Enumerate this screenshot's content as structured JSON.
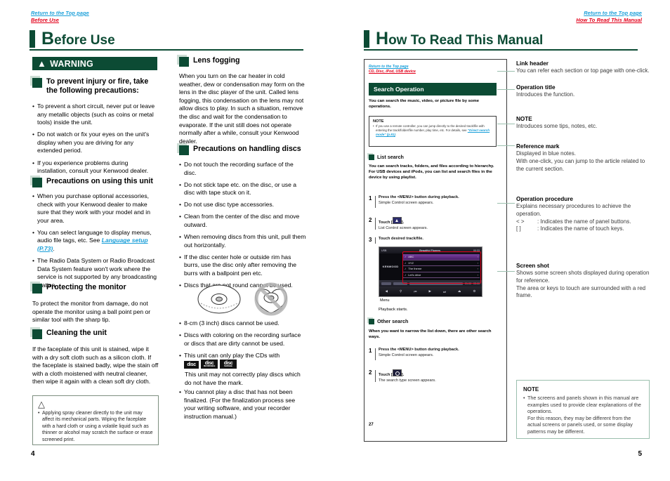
{
  "left_page": {
    "link_header": {
      "top": "Return to the Top page",
      "section": "Before Use"
    },
    "chapter_title_cap": "B",
    "chapter_title_rest": "efore Use",
    "warning_label": "WARNING",
    "warning_icon": "warning-triangle-icon",
    "page_number": "4",
    "col1": {
      "h1": "To prevent injury or fire, take the following precautions:",
      "h1_bullets": [
        "To prevent a short circuit, never put or leave any metallic objects (such as coins or metal tools) inside the unit.",
        "Do not watch or fix your eyes on the unit's display when you are driving for any extended period.",
        "If you experience problems during installation, consult your Kenwood dealer."
      ],
      "h2": "Precautions on using this unit",
      "h2_bullets_a": "When you purchase optional accessories, check with your Kenwood dealer to make sure that they work with your model and in your area.",
      "h2_bullets_b_pre": "You can select language to display menus, audio file tags, etc. See ",
      "h2_bullets_b_link": "Language setup (P.73)",
      "h2_bullets_b_post": ".",
      "h2_bullets_c": "The Radio Data System or Radio Broadcast Data System feature won't work where the service is not supported by any broadcasting station.",
      "h3": "Protecting the monitor",
      "h3_body": "To protect the monitor from damage, do not operate the monitor using a ball point pen or similar tool with the sharp tip.",
      "h4": "Cleaning the unit",
      "h4_body": "If the faceplate of this unit is stained, wipe it with a dry soft cloth such as a silicon cloth. If the faceplate is stained badly, wipe the stain off with a cloth moistened with neutral cleaner, then wipe it again with a clean soft dry cloth.",
      "caution_icon": "caution-triangle-icon",
      "caution_text": "Applying spray cleaner directly to the unit may affect its mechanical parts. Wiping the faceplate with a hard cloth or using a volatile liquid such as thinner or alcohol may scratch the surface or erase screened print."
    },
    "col2": {
      "h1": "Lens fogging",
      "h1_body": "When you turn on the car heater in cold weather, dew or condensation may form on the lens in the disc player of the unit. Called lens fogging, this condensation on the lens may not allow discs to play. In such a situation, remove the disc and wait for the condensation to evaporate. If the unit still does not operate normally after a while, consult your Kenwood dealer.",
      "h2": "Precautions on handling discs",
      "h2_bullets": [
        "Do not touch the recording surface of the disc.",
        "Do not stick tape etc. on the disc, or use a disc with tape stuck on it.",
        "Do not use disc type accessories.",
        "Clean from the center of the disc and move outward.",
        "When removing discs from this unit, pull them out horizontally.",
        "If the disc center hole or outside rim has burrs, use the disc only after removing the burrs with a ballpoint pen etc.",
        "Discs that are not round cannot be used."
      ],
      "disc_ok_icon": "round-disc-icon",
      "disc_ng_icon": "heart-shaped-disc-prohibited-icon",
      "h2_bullets_b": [
        "8-cm (3 inch) discs cannot be used.",
        "Discs with coloring on the recording surface or discs that are dirty cannot be used."
      ],
      "cd_line": "This unit can only play the CDs with",
      "cd_logos": [
        {
          "big": "disc",
          "sm": ""
        },
        {
          "big": "disc",
          "sm": "RECORDABLE"
        },
        {
          "big": "disc",
          "sm": "ReWritable"
        }
      ],
      "cd_after": "This unit may not correctly play discs which do not have the mark.",
      "last_bullet": "You cannot play a disc that has not been finalized. (For the finalization process see your writing software, and your recorder instruction manual.)"
    }
  },
  "right_page": {
    "link_header": {
      "top": "Return to the Top page",
      "section": "How To Read This Manual"
    },
    "chapter_title_cap": "H",
    "chapter_title_rest": "ow To Read This Manual",
    "page_number": "5",
    "sample": {
      "link_header": {
        "top": "Return to the Top page",
        "section": "CD, Disc, iPod, USB device"
      },
      "operation_title": "Search Operation",
      "intro": "You can search the music, video, or picture file by some operations.",
      "note_label": "NOTE",
      "note_text_pre": "If you use a remote controller, you can jump directly to the desired track/file with entering the track/folder/file number, play time, etc. For details, see ",
      "note_link": "\"Direct search mode\" (p.81)",
      "note_text_post": ".",
      "h_list": "List search",
      "list_body": "You can search tracks, folders, and files according to hierarchy.\nFor USB devices and iPods, you can list and search files in the device by using playlist.",
      "steps_list": [
        {
          "num": "1",
          "bold": "Press the <MENU> button during playback.",
          "sub": "Simple Control screen appears.",
          "icon": ""
        },
        {
          "num": "2",
          "bold_pre": "Touch [",
          "icon": "list-key-icon",
          "bold_post": "].",
          "sub": "List Control screen appears."
        },
        {
          "num": "3",
          "bold": "Touch desired track/file.",
          "sub": ""
        }
      ],
      "device": {
        "source_label": "USB",
        "title": "Beautiful Flowers",
        "time": "00:33",
        "brand": "KENWOOD",
        "rows": [
          "ABC",
          "XYZ",
          "The theme",
          "Let's drive"
        ],
        "elapsed": "01:00",
        "total": "03:00",
        "menu_label": "Menu"
      },
      "after_device": "Playback starts.",
      "h_other": "Other search",
      "other_body": "When you want to narrow the list down, there are other search ways.",
      "steps_other": [
        {
          "num": "1",
          "bold": "Press the <MENU> button during playback.",
          "sub": "Simple Control screen appears."
        },
        {
          "num": "2",
          "bold_pre": "Touch [",
          "icon": "search-key-icon",
          "bold_post": "].",
          "sub": "The search type screen appears."
        }
      ],
      "page_number": "27"
    },
    "annotations": [
      {
        "title": "Link header",
        "body": "You can refer each section or top page with one-click."
      },
      {
        "title": "Operation title",
        "body": "Introduces the function."
      },
      {
        "title": "NOTE",
        "body": "Introduces some tips, notes, etc."
      },
      {
        "title": "Reference mark",
        "body": "Displayed in blue notes.\nWith one-click, you can jump to the article related to the current section."
      },
      {
        "title": "Operation procedure",
        "body": "Explains necessary procedures to achieve the operation.",
        "extra1_key": "<    >",
        "extra1_val": ": Indicates the name of panel buttons.",
        "extra2_key": "[      ]",
        "extra2_val": ": Indicates the name of touch keys."
      },
      {
        "title": "Screen shot",
        "body": "Shows some screen shots displayed during operation for reference.\nThe area or keys to touch are surrounded with a red frame."
      }
    ],
    "note_box": {
      "label": "NOTE",
      "text": "The screens and panels shown in this manual are examples used to provide clear explanations of the operations.\nFor this reason, they may be different from the actual screens or panels used, or some display patterns may be different."
    }
  }
}
